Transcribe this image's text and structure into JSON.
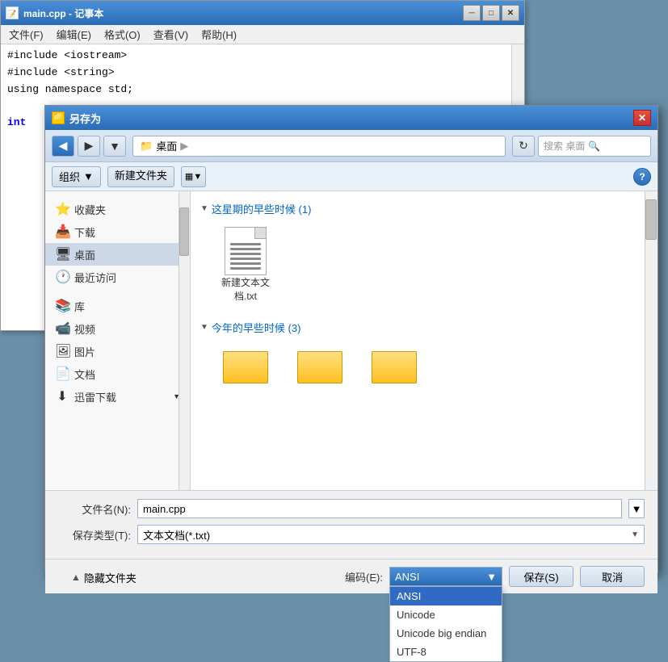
{
  "notepad": {
    "title": "main.cpp - 记事本",
    "menu": {
      "file": "文件(F)",
      "edit": "编辑(E)",
      "format": "格式(O)",
      "view": "查看(V)",
      "help": "帮助(H)"
    },
    "code_lines": [
      "#include <iostream>",
      "#include <string>",
      "using namespace std;",
      "",
      "int"
    ],
    "controls": {
      "minimize": "─",
      "maximize": "□",
      "close": "✕"
    }
  },
  "saveas": {
    "title": "另存为",
    "toolbar": {
      "back_btn": "◀",
      "forward_btn": "▶",
      "dropdown_btn": "▼",
      "path_folder_icon": "📁",
      "path_label": "桌面",
      "path_arrow": "▶",
      "refresh_btn": "↻",
      "search_placeholder": "搜索 桌面",
      "search_icon": "🔍"
    },
    "toolbar2": {
      "organize_label": "组织",
      "organize_arrow": "▼",
      "new_folder_label": "新建文件夹",
      "view_icon1": "▦",
      "view_arrow": "▼",
      "help_label": "?"
    },
    "sidebar": {
      "items": [
        {
          "icon": "⭐",
          "label": "收藏夹"
        },
        {
          "icon": "📥",
          "label": "下载"
        },
        {
          "icon": "🖥",
          "label": "桌面",
          "selected": true
        },
        {
          "icon": "🕐",
          "label": "最近访问"
        },
        {
          "icon": "📚",
          "label": "库"
        },
        {
          "icon": "📹",
          "label": "视频"
        },
        {
          "icon": "🖼",
          "label": "图片"
        },
        {
          "icon": "📄",
          "label": "文档"
        },
        {
          "icon": "⬇",
          "label": "迅雷下载"
        }
      ]
    },
    "files": {
      "sections": [
        {
          "title": "这星期的早些时候 (1)",
          "items": [
            {
              "type": "file",
              "name": "新建文本文档.txt"
            }
          ]
        },
        {
          "title": "今年的早些时候 (3)",
          "items": [
            {
              "type": "folder",
              "name": ""
            },
            {
              "type": "folder",
              "name": ""
            },
            {
              "type": "folder",
              "name": ""
            }
          ]
        }
      ]
    },
    "form": {
      "filename_label": "文件名(N):",
      "filename_value": "main.cpp",
      "filetype_label": "保存类型(T):",
      "filetype_value": "文本文档(*.txt)"
    },
    "actions": {
      "hide_files_icon": "▲",
      "hide_files_label": "隐藏文件夹",
      "encoding_label": "编码(E):",
      "encoding_value": "ANSI",
      "encoding_arrow": "▼",
      "save_label": "保存(S)",
      "cancel_label": "取消",
      "encoding_options": [
        {
          "value": "ANSI",
          "selected": true
        },
        {
          "value": "Unicode",
          "selected": false
        },
        {
          "value": "Unicode big endian",
          "selected": false
        },
        {
          "value": "UTF-8",
          "selected": false
        }
      ]
    }
  }
}
